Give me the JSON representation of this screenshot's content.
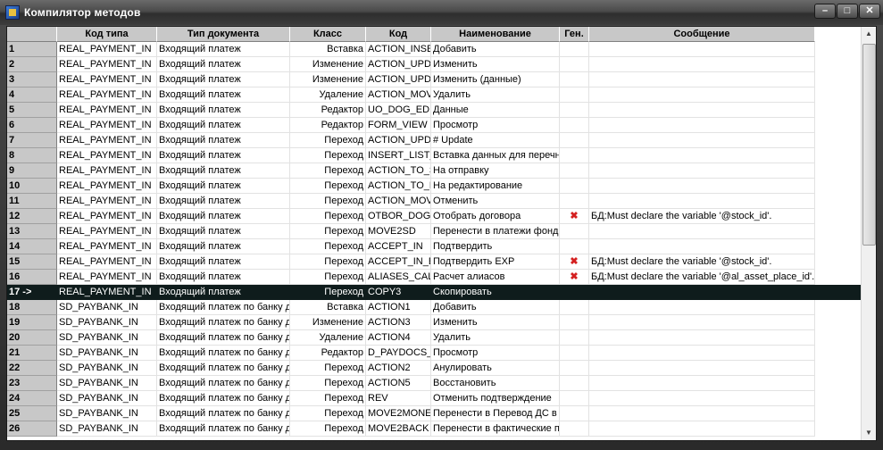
{
  "window": {
    "title": "Компилятор методов",
    "buttons": {
      "minimize": "–",
      "maximize": "□",
      "close": "✕"
    }
  },
  "columns": [
    "",
    "Код типа",
    "Тип документа",
    "Класс",
    "Код",
    "Наименование",
    "Ген.",
    "Сообщение"
  ],
  "error_mark": "✖",
  "accent": {
    "selection": "#0f1c1c",
    "header": "#c8c8c8",
    "error": "#d42020"
  },
  "rows": [
    {
      "num": "1",
      "type_code": "REAL_PAYMENT_IN",
      "doc_type": "Входящий платеж",
      "klass": "Вставка",
      "code": "ACTION_INSE",
      "name": "Добавить",
      "gen": "",
      "message": ""
    },
    {
      "num": "2",
      "type_code": "REAL_PAYMENT_IN",
      "doc_type": "Входящий платеж",
      "klass": "Изменение",
      "code": "ACTION_UPD",
      "name": "Изменить",
      "gen": "",
      "message": ""
    },
    {
      "num": "3",
      "type_code": "REAL_PAYMENT_IN",
      "doc_type": "Входящий платеж",
      "klass": "Изменение",
      "code": "ACTION_UPD",
      "name": "Изменить (данные)",
      "gen": "",
      "message": ""
    },
    {
      "num": "4",
      "type_code": "REAL_PAYMENT_IN",
      "doc_type": "Входящий платеж",
      "klass": "Удаление",
      "code": "ACTION_MOV",
      "name": "Удалить",
      "gen": "",
      "message": ""
    },
    {
      "num": "5",
      "type_code": "REAL_PAYMENT_IN",
      "doc_type": "Входящий платеж",
      "klass": "Редактор",
      "code": "UO_DOG_EDI",
      "name": "Данные",
      "gen": "",
      "message": ""
    },
    {
      "num": "6",
      "type_code": "REAL_PAYMENT_IN",
      "doc_type": "Входящий платеж",
      "klass": "Редактор",
      "code": "FORM_VIEW",
      "name": "Просмотр",
      "gen": "",
      "message": ""
    },
    {
      "num": "7",
      "type_code": "REAL_PAYMENT_IN",
      "doc_type": "Входящий платеж",
      "klass": "Переход",
      "code": "ACTION_UPD",
      "name": "# Update",
      "gen": "",
      "message": ""
    },
    {
      "num": "8",
      "type_code": "REAL_PAYMENT_IN",
      "doc_type": "Входящий платеж",
      "klass": "Переход",
      "code": "INSERT_LIST_",
      "name": "Вставка данных для перечн",
      "gen": "",
      "message": ""
    },
    {
      "num": "9",
      "type_code": "REAL_PAYMENT_IN",
      "doc_type": "Входящий платеж",
      "klass": "Переход",
      "code": "ACTION_TO_S",
      "name": "На отправку",
      "gen": "",
      "message": ""
    },
    {
      "num": "10",
      "type_code": "REAL_PAYMENT_IN",
      "doc_type": "Входящий платеж",
      "klass": "Переход",
      "code": "ACTION_TO_E",
      "name": "На редактирование",
      "gen": "",
      "message": ""
    },
    {
      "num": "11",
      "type_code": "REAL_PAYMENT_IN",
      "doc_type": "Входящий платеж",
      "klass": "Переход",
      "code": "ACTION_MOV",
      "name": "Отменить",
      "gen": "",
      "message": ""
    },
    {
      "num": "12",
      "type_code": "REAL_PAYMENT_IN",
      "doc_type": "Входящий платеж",
      "klass": "Переход",
      "code": "OTBOR_DOG(",
      "name": "Отобрать договора",
      "gen": "x",
      "message": "БД:Must declare the variable '@stock_id'."
    },
    {
      "num": "13",
      "type_code": "REAL_PAYMENT_IN",
      "doc_type": "Входящий платеж",
      "klass": "Переход",
      "code": "MOVE2SD",
      "name": "Перенести в платежи фонда",
      "gen": "",
      "message": ""
    },
    {
      "num": "14",
      "type_code": "REAL_PAYMENT_IN",
      "doc_type": "Входящий платеж",
      "klass": "Переход",
      "code": "ACCEPT_IN",
      "name": "Подтвердить",
      "gen": "",
      "message": ""
    },
    {
      "num": "15",
      "type_code": "REAL_PAYMENT_IN",
      "doc_type": "Входящий платеж",
      "klass": "Переход",
      "code": "ACCEPT_IN_E",
      "name": "Подтвердить EXP",
      "gen": "x",
      "message": "БД:Must declare the variable '@stock_id'."
    },
    {
      "num": "16",
      "type_code": "REAL_PAYMENT_IN",
      "doc_type": "Входящий платеж",
      "klass": "Переход",
      "code": "ALIASES_CAL",
      "name": "Расчет алиасов",
      "gen": "x",
      "message": "БД:Must declare the variable '@al_asset_place_id'."
    },
    {
      "num": "17 ->",
      "type_code": "REAL_PAYMENT_IN",
      "doc_type": "Входящий платеж",
      "klass": "Переход",
      "code": "COPY3",
      "name": "Скопировать",
      "gen": "",
      "message": "",
      "selected": true
    },
    {
      "num": "18",
      "type_code": "SD_PAYBANK_IN",
      "doc_type": "Входящий платеж по банку д",
      "klass": "Вставка",
      "code": "ACTION1",
      "name": "Добавить",
      "gen": "",
      "message": ""
    },
    {
      "num": "19",
      "type_code": "SD_PAYBANK_IN",
      "doc_type": "Входящий платеж по банку д",
      "klass": "Изменение",
      "code": "ACTION3",
      "name": "Изменить",
      "gen": "",
      "message": ""
    },
    {
      "num": "20",
      "type_code": "SD_PAYBANK_IN",
      "doc_type": "Входящий платеж по банку д",
      "klass": "Удаление",
      "code": "ACTION4",
      "name": "Удалить",
      "gen": "",
      "message": ""
    },
    {
      "num": "21",
      "type_code": "SD_PAYBANK_IN",
      "doc_type": "Входящий платеж по банку д",
      "klass": "Редактор",
      "code": "D_PAYDOCS_",
      "name": "Просмотр",
      "gen": "",
      "message": ""
    },
    {
      "num": "22",
      "type_code": "SD_PAYBANK_IN",
      "doc_type": "Входящий платеж по банку д",
      "klass": "Переход",
      "code": "ACTION2",
      "name": "Анулировать",
      "gen": "",
      "message": ""
    },
    {
      "num": "23",
      "type_code": "SD_PAYBANK_IN",
      "doc_type": "Входящий платеж по банку д",
      "klass": "Переход",
      "code": "ACTION5",
      "name": "Восстановить",
      "gen": "",
      "message": ""
    },
    {
      "num": "24",
      "type_code": "SD_PAYBANK_IN",
      "doc_type": "Входящий платеж по банку д",
      "klass": "Переход",
      "code": "REV",
      "name": "Отменить подтверждение",
      "gen": "",
      "message": ""
    },
    {
      "num": "25",
      "type_code": "SD_PAYBANK_IN",
      "doc_type": "Входящий платеж по банку д",
      "klass": "Переход",
      "code": "MOVE2MONEY",
      "name": "Перенести в Перевод ДС в",
      "gen": "",
      "message": ""
    },
    {
      "num": "26",
      "type_code": "SD_PAYBANK_IN",
      "doc_type": "Входящий платеж по банку д",
      "klass": "Переход",
      "code": "MOVE2BACK",
      "name": "Перенести в фактические п",
      "gen": "",
      "message": ""
    }
  ]
}
